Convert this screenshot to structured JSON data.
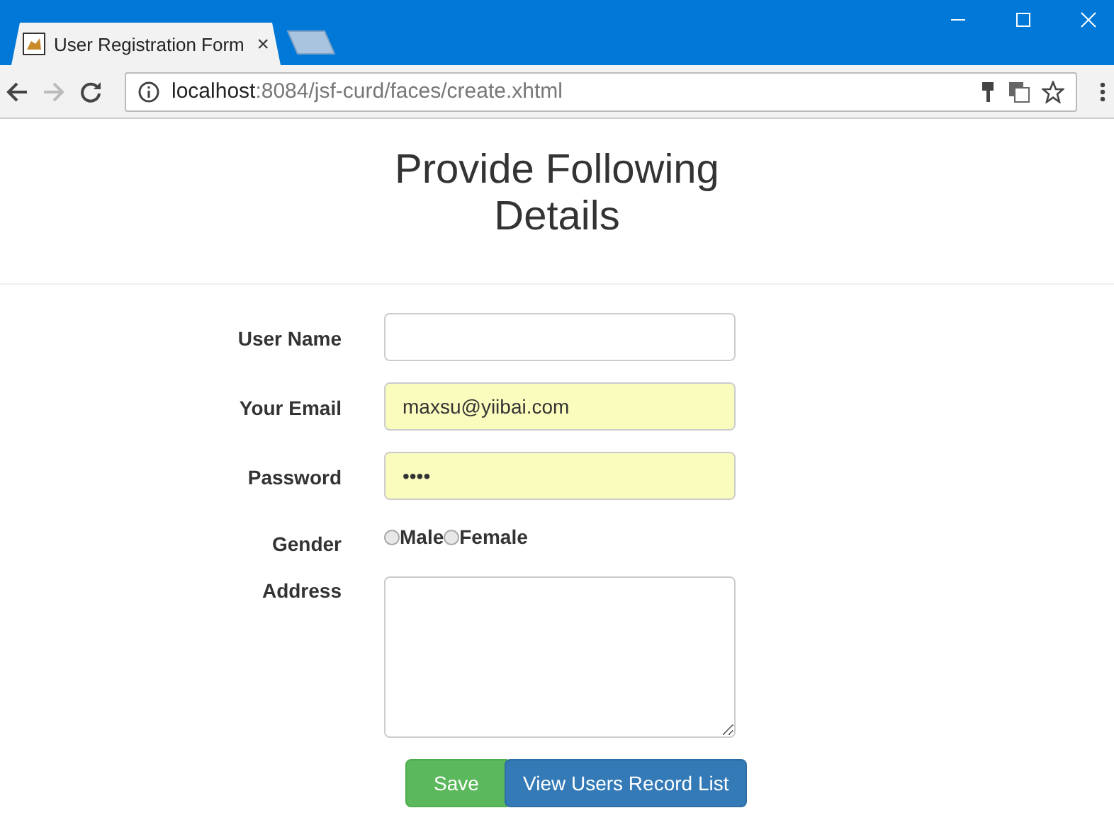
{
  "browser": {
    "tab": {
      "title": "User Registration Form",
      "close": "×"
    },
    "address": {
      "host": "localhost",
      "path": ":8084/jsf-curd/faces/create.xhtml"
    }
  },
  "heading": "Provide Following Details",
  "fields": [
    {
      "kind": "text",
      "label": "User Name",
      "autofilled": false
    },
    {
      "kind": "text",
      "label": "Your Email",
      "value": "maxsu@yiibai.com",
      "autofilled": true
    },
    {
      "kind": "password",
      "label": "Password",
      "value": "••••",
      "autofilled": true
    },
    {
      "kind": "radio",
      "label": "Gender",
      "options": [
        {
          "label": "Male",
          "selected": false
        },
        {
          "label": "Female",
          "selected": false
        }
      ]
    },
    {
      "kind": "textarea",
      "label": "Address"
    }
  ],
  "buttons": [
    {
      "label": "Save",
      "kind": "success"
    },
    {
      "label": "View Users Record List",
      "kind": "primary"
    }
  ]
}
